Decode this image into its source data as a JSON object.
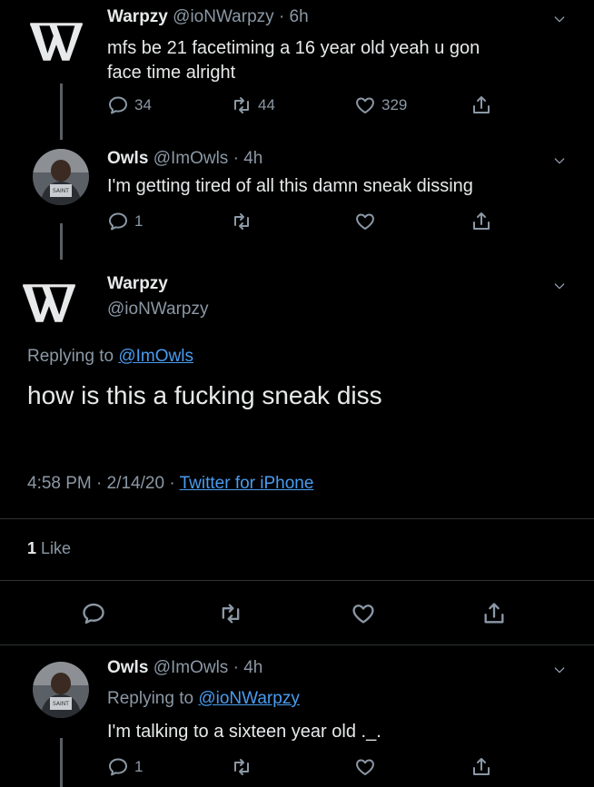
{
  "tweet1": {
    "name": "Warpzy",
    "handle": "@ioNWarpzy",
    "time": "· 6h",
    "text_line1": "mfs be 21 facetiming a 16 year old yeah u gon",
    "text_line2": "face time alright",
    "replies": "34",
    "retweets": "44",
    "likes": "329"
  },
  "tweet2": {
    "name": "Owls",
    "handle": "@ImOwls",
    "time": "· 4h",
    "text": "I'm getting tired of all this damn sneak dissing",
    "replies": "1"
  },
  "main_tweet": {
    "name": "Warpzy",
    "handle": "@ioNWarpzy",
    "replying_prefix": "Replying to",
    "replying_to": "@ImOwls",
    "text": "how is this a fucking sneak diss",
    "time": "4:58 PM · 2/14/20 ·",
    "source": "Twitter for iPhone",
    "likes_count": "1",
    "likes_label": "Like"
  },
  "tweet3": {
    "name": "Owls",
    "handle": "@ImOwls",
    "time": "· 4h",
    "replying_prefix": "Replying to",
    "replying_to": "@ioNWarpzy",
    "text": "I'm talking to a sixteen year old ._.",
    "replies": "1"
  },
  "icons": {
    "reply": "reply-icon",
    "retweet": "retweet-icon",
    "like": "heart-icon",
    "share": "share-icon",
    "more": "chevron-down-icon"
  },
  "colors": {
    "background": "#000000",
    "text": "#e7e9ea",
    "muted": "#8b98a5",
    "link": "#4a9cf0"
  }
}
